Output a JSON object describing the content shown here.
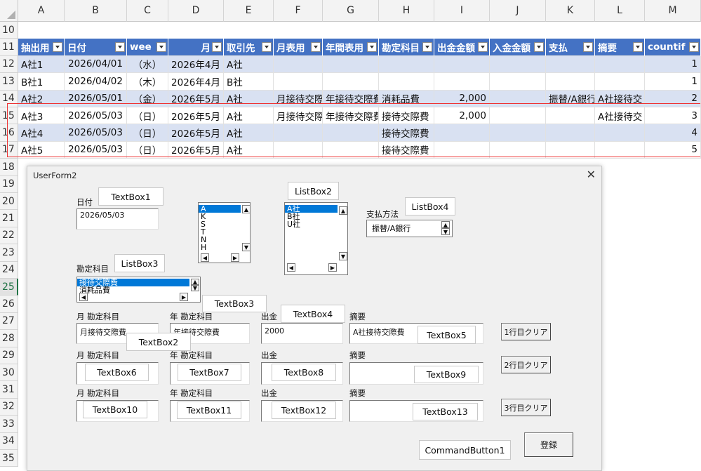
{
  "columns": [
    "A",
    "B",
    "C",
    "D",
    "E",
    "F",
    "G",
    "H",
    "I",
    "J",
    "K",
    "L",
    "M"
  ],
  "rows": [
    "10",
    "11",
    "12",
    "13",
    "14",
    "15",
    "16",
    "17",
    "18",
    "19",
    "20",
    "21",
    "22",
    "23",
    "24",
    "25",
    "26",
    "27",
    "28",
    "29",
    "30",
    "31",
    "32",
    "33",
    "34",
    "35"
  ],
  "selected_row": "25",
  "table_headers": [
    "抽出用",
    "日付",
    "wee",
    "月",
    "取引先",
    "月表用",
    "年間表用",
    "勘定科目",
    "出金金額",
    "入金金額",
    "支払",
    "摘要",
    "countif"
  ],
  "table_rows": [
    [
      "A社1",
      "2026/04/01",
      "（水）",
      "2026年4月",
      "A社",
      "",
      "",
      "",
      "",
      "",
      "",
      "",
      "1"
    ],
    [
      "B社1",
      "2026/04/02",
      "（木）",
      "2026年4月",
      "B社",
      "",
      "",
      "",
      "",
      "",
      "",
      "",
      "1"
    ],
    [
      "A社2",
      "2026/05/01",
      "（金）",
      "2026年5月",
      "A社",
      "月接待交際",
      "年接待交際費",
      "消耗品費",
      "2,000",
      "",
      "振替/A銀行",
      "A社接待交",
      "2"
    ],
    [
      "A社3",
      "2026/05/03",
      "（日）",
      "2026年5月",
      "A社",
      "月接待交際",
      "年接待交際費",
      "接待交際費",
      "2,000",
      "",
      "",
      "A社接待交",
      "3"
    ],
    [
      "A社4",
      "2026/05/03",
      "（日）",
      "2026年5月",
      "A社",
      "",
      "",
      "接待交際費",
      "",
      "",
      "",
      "",
      "4"
    ],
    [
      "A社5",
      "2026/05/03",
      "（日）",
      "2026年5月",
      "A社",
      "",
      "",
      "接待交際費",
      "",
      "",
      "",
      "",
      "5"
    ]
  ],
  "form": {
    "title": "UserForm2",
    "close": "✕",
    "date_label": "日付",
    "date_value": "2026/05/03",
    "tb1_label": "TextBox1",
    "listbox1_items": [
      "A",
      "K",
      "S",
      "T",
      "N",
      "H"
    ],
    "listbox2_label": "ListBox2",
    "listbox2_items": [
      "A社",
      "B社",
      "U社"
    ],
    "pay_label": "支払方法",
    "listbox4_label": "ListBox4",
    "listbox4_value": "振替/A銀行",
    "kanjo_label": "勘定科目",
    "listbox3_label": "ListBox3",
    "listbox3_items": [
      "接待交際費",
      "消耗品費"
    ],
    "tb3_label": "TextBox3",
    "col_month": "月 勘定科目",
    "col_year": "年 勘定科目",
    "col_out": "出金",
    "col_memo": "摘要",
    "tb4_label": "TextBox4",
    "row1_month": "月接待交際費",
    "row1_year": "年接待交際費",
    "row1_out": "2000",
    "row1_memo": "A社接待交際費",
    "tb2_label": "TextBox2",
    "tb5_label": "TextBox5",
    "tb6": "TextBox6",
    "tb7": "TextBox7",
    "tb8": "TextBox8",
    "tb9": "TextBox9",
    "tb10": "TextBox10",
    "tb11": "TextBox11",
    "tb12": "TextBox12",
    "tb13": "TextBox13",
    "clear1": "1行目クリア",
    "clear2": "2行目クリア",
    "clear3": "3行目クリア",
    "cmd1_label": "CommandButton1",
    "register": "登録"
  }
}
